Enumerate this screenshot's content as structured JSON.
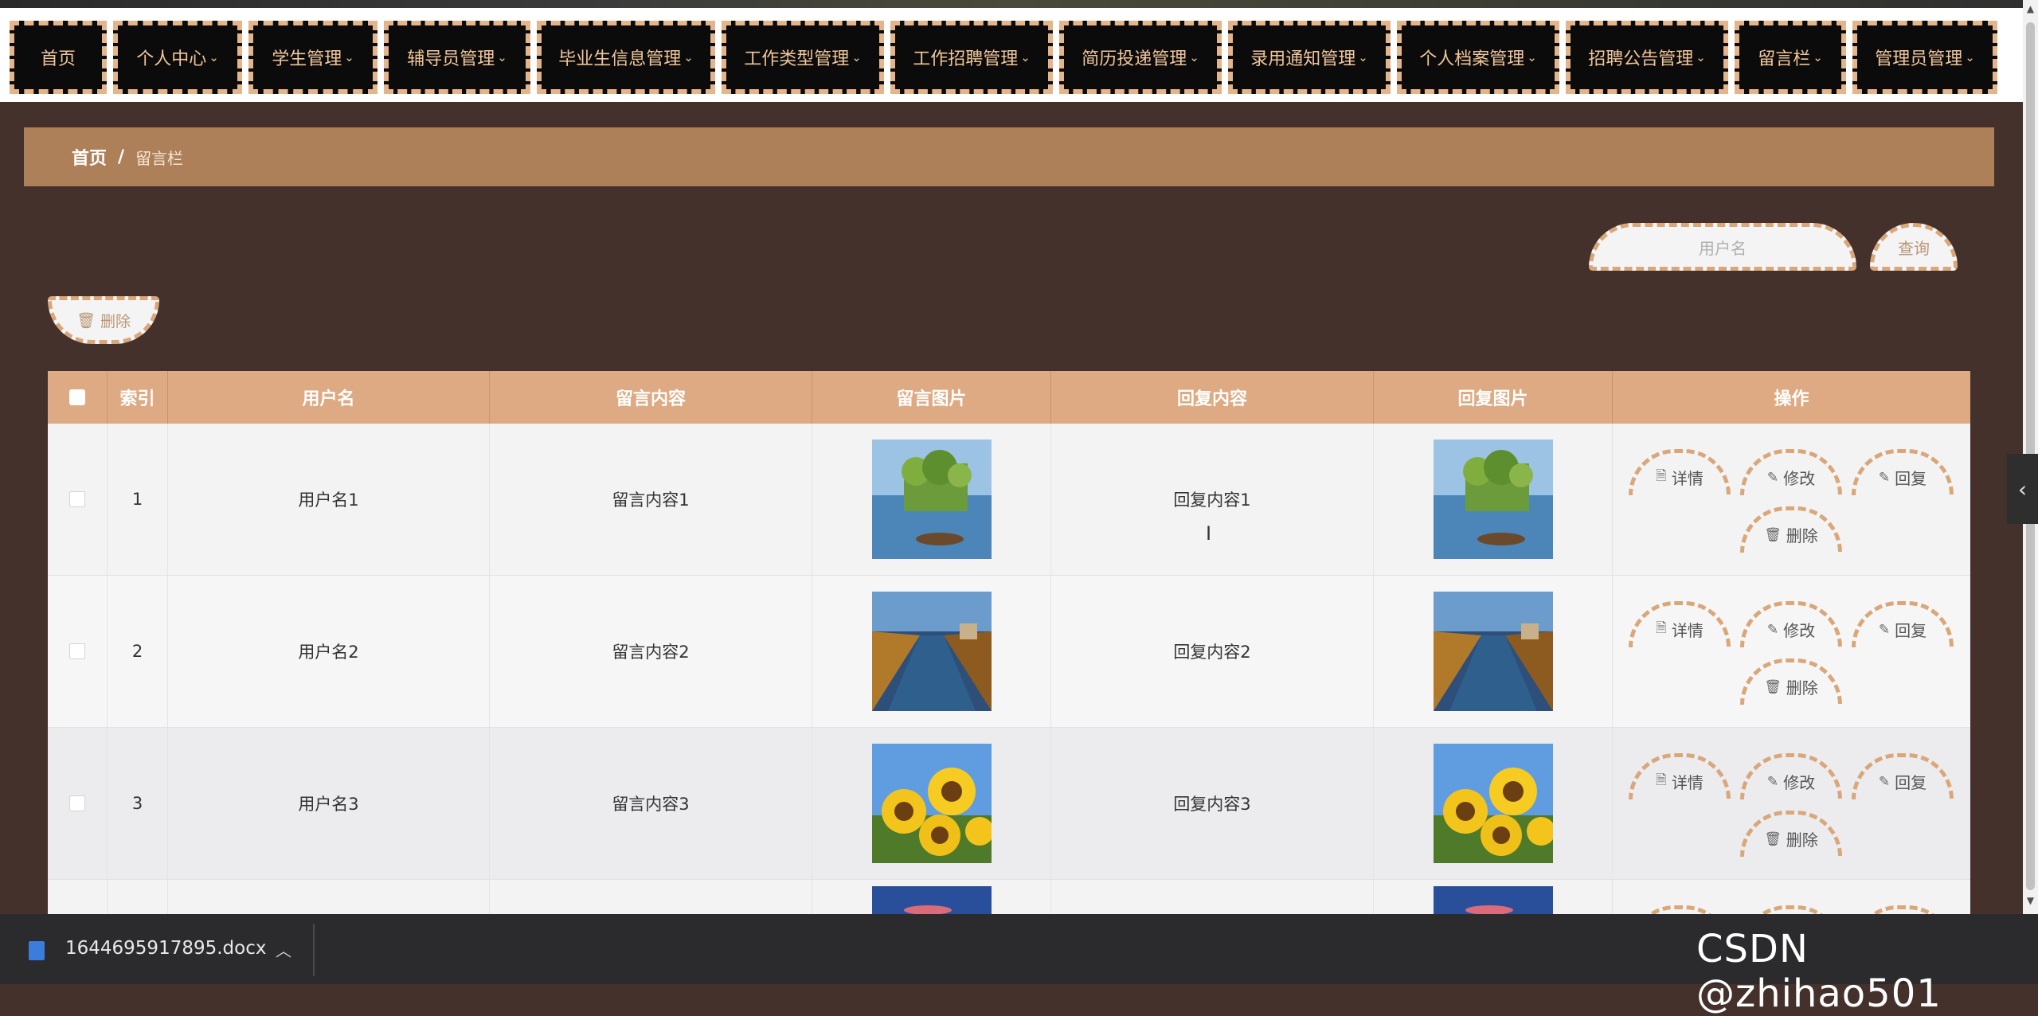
{
  "nav": {
    "items": [
      {
        "label": "首页",
        "has_dropdown": false
      },
      {
        "label": "个人中心",
        "has_dropdown": true
      },
      {
        "label": "学生管理",
        "has_dropdown": true
      },
      {
        "label": "辅导员管理",
        "has_dropdown": true
      },
      {
        "label": "毕业生信息管理",
        "has_dropdown": true
      },
      {
        "label": "工作类型管理",
        "has_dropdown": true
      },
      {
        "label": "工作招聘管理",
        "has_dropdown": true
      },
      {
        "label": "简历投递管理",
        "has_dropdown": true
      },
      {
        "label": "录用通知管理",
        "has_dropdown": true
      },
      {
        "label": "个人档案管理",
        "has_dropdown": true
      },
      {
        "label": "招聘公告管理",
        "has_dropdown": true
      },
      {
        "label": "留言栏",
        "has_dropdown": true
      },
      {
        "label": "管理员管理",
        "has_dropdown": true
      }
    ]
  },
  "breadcrumb": {
    "home": "首页",
    "separator": "/",
    "current": "留言栏"
  },
  "search": {
    "placeholder": "用户名",
    "button_label": "查询"
  },
  "toolbar": {
    "delete_label": "删除"
  },
  "table": {
    "columns": [
      "",
      "索引",
      "用户名",
      "留言内容",
      "留言图片",
      "回复内容",
      "回复图片",
      "操作"
    ],
    "rows": [
      {
        "index": "1",
        "username": "用户名1",
        "message": "留言内容1",
        "message_image": "lake-landscape",
        "reply": "回复内容1",
        "reply_image": "lake-landscape"
      },
      {
        "index": "2",
        "username": "用户名2",
        "message": "留言内容2",
        "message_image": "autumn-road",
        "reply": "回复内容2",
        "reply_image": "autumn-road"
      },
      {
        "index": "3",
        "username": "用户名3",
        "message": "留言内容3",
        "message_image": "sunflowers",
        "reply": "回复内容3",
        "reply_image": "sunflowers"
      },
      {
        "index": "",
        "username": "",
        "message": "",
        "message_image": "night-sky",
        "reply": "",
        "reply_image": "night-sky"
      }
    ],
    "actions": {
      "detail": "详情",
      "edit": "修改",
      "reply": "回复",
      "delete": "删除"
    }
  },
  "download_bar": {
    "filename": "1644695917895.docx"
  },
  "watermark": "CSDN @zhihao501",
  "colors": {
    "page_bg": "#45312b",
    "nav_bg": "#0b0b0b",
    "nav_border": "#e4b48a",
    "nav_text": "#f1c69a",
    "breadcrumb_bg": "#ad8059",
    "table_header": "#deaa83",
    "button_border": "#d9a77a"
  },
  "icons": {
    "chevron": "chevron-down-icon",
    "delete": "trash-icon",
    "detail": "document-icon",
    "edit": "pencil-icon",
    "reply": "pencil-icon",
    "side": "chevron-left-icon"
  }
}
